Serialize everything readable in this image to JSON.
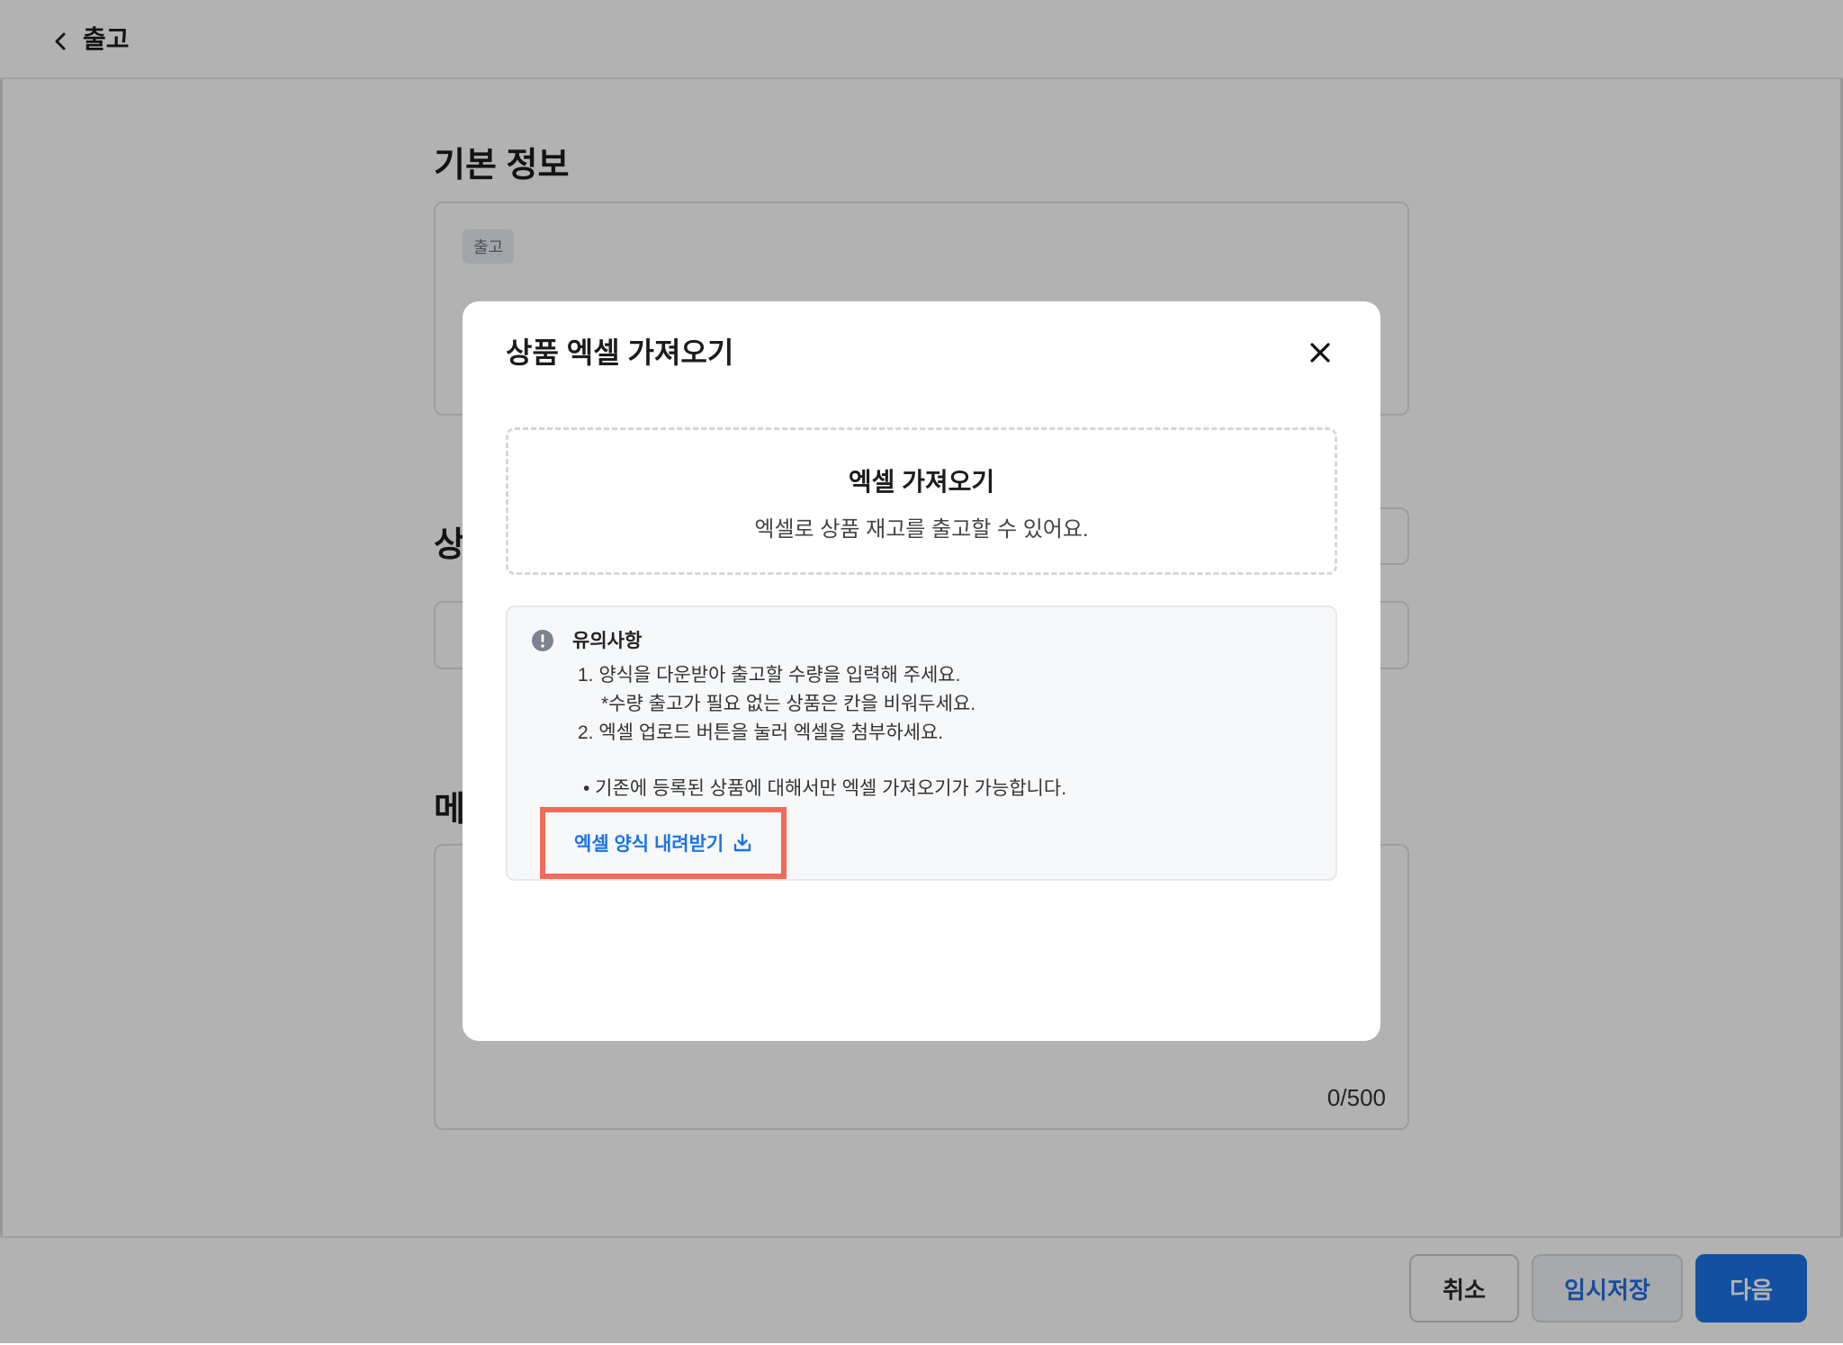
{
  "header": {
    "title": "출고"
  },
  "background": {
    "section_basic": "기본 정보",
    "section_product_partial": "상",
    "section_memo_partial": "메",
    "tag": "출고",
    "memo_counter": "0/500"
  },
  "footer": {
    "cancel_label": "취소",
    "draft_label": "임시저장",
    "next_label": "다음"
  },
  "modal": {
    "title": "상품 엑셀 가져오기",
    "dropzone": {
      "title": "엑셀 가져오기",
      "description": "엑셀로 상품 재고를 출고할 수 있어요."
    },
    "notice": {
      "title": "유의사항",
      "lines": [
        "1. 양식을 다운받아 출고할 수량을 입력해 주세요.",
        "*수량 출고가 필요 없는 상품은 칸을 비워두세요.",
        "2. 엑셀 업로드 버튼을 눌러 엑셀을 첨부하세요.",
        "• 기존에 등록된 상품에 대해서만 엑셀 가져오기가 가능합니다."
      ],
      "download_label": "엑셀 양식 내려받기"
    }
  },
  "colors": {
    "primary": "#1a73e8",
    "highlight": "#f26a5a",
    "overlay": "rgba(0,0,0,0.30)"
  }
}
